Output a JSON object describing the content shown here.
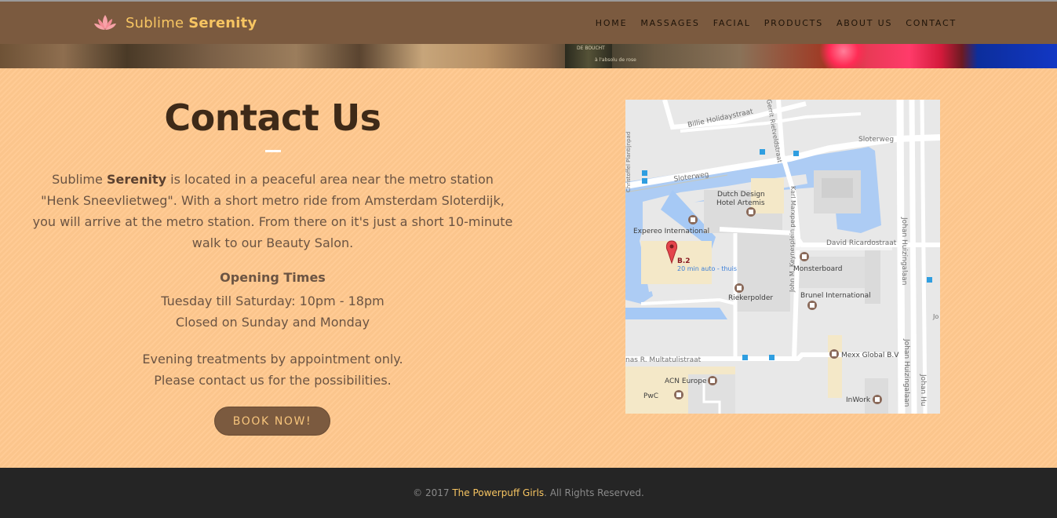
{
  "brand": {
    "name_regular": "Sublime",
    "name_bold": "Serenity",
    "logo_icon": "lotus-icon"
  },
  "nav": {
    "items": [
      {
        "label": "HOME"
      },
      {
        "label": "MASSAGES"
      },
      {
        "label": "FACIAL"
      },
      {
        "label": "PRODUCTS"
      },
      {
        "label": "ABOUT US"
      },
      {
        "label": "CONTACT"
      }
    ]
  },
  "hero_strip": {
    "label_top": "DE BOUCHT",
    "label_bottom": "à l'absolu de rose"
  },
  "contact": {
    "title": "Contact Us",
    "intro_brand_regular": "Sublime",
    "intro_brand_bold": "Serenity",
    "intro_text": " is located in a peaceful area near the metro station \"Henk Sneevlietweg\". With a short metro ride from Amsterdam Sloterdijk, you will arrive at the metro station. From there on it's just a short 10-minute walk to our Beauty Salon.",
    "hours_title": "Opening Times",
    "hours_line1": "Tuesday till Saturday: 10pm - 18pm",
    "hours_line2": "Closed on Sunday and Monday",
    "evening_line1": "Evening treatments by appointment only.",
    "evening_line2": "Please contact us for the possibilities.",
    "book_label": "BOOK NOW!"
  },
  "map": {
    "labels": {
      "billie": "Billie Holidaystraat",
      "sloterweg_top": "Sloterweg",
      "sloterweg_left": "Sloterweg",
      "dutch_design1": "Dutch Design",
      "dutch_design2": "Hotel Artemis",
      "expereo": "Expereo International",
      "david": "David Ricardostraat",
      "marker_label": "B.2",
      "marker_sub": "20 min auto - thuis",
      "monsterboard": "Monsterboard",
      "riekerpolder": "Riekerpolder",
      "brunel": "Brunel International",
      "mexx": "Mexx Global B.V",
      "multatuli": "nas R. Multatulistraat",
      "acn": "ACN Europe",
      "pwc": "PwC",
      "inwork": "InWork",
      "karl": "Karl Marxpad",
      "keynes": "John M. Keynesplein",
      "huizinga1": "Johan Huizingalaan",
      "huizinga2": "Johan Huizingalaan",
      "huizinga3": "Johan Hu",
      "planting": "Christoffel Plantijnpad",
      "rietveld": "Gerrit Rietveldstraat",
      "jo": "Jo"
    },
    "marker_icon": "map-pin-icon"
  },
  "footer": {
    "prefix": "© 2017 ",
    "link": "The Powerpuff Girls",
    "suffix": ". All Rights Reserved."
  },
  "colors": {
    "nav_bg": "#7b5a3f",
    "brand_gold": "#f7c562",
    "page_bg": "#ffc88e",
    "title": "#3e2a18",
    "footer_bg": "#252525"
  }
}
